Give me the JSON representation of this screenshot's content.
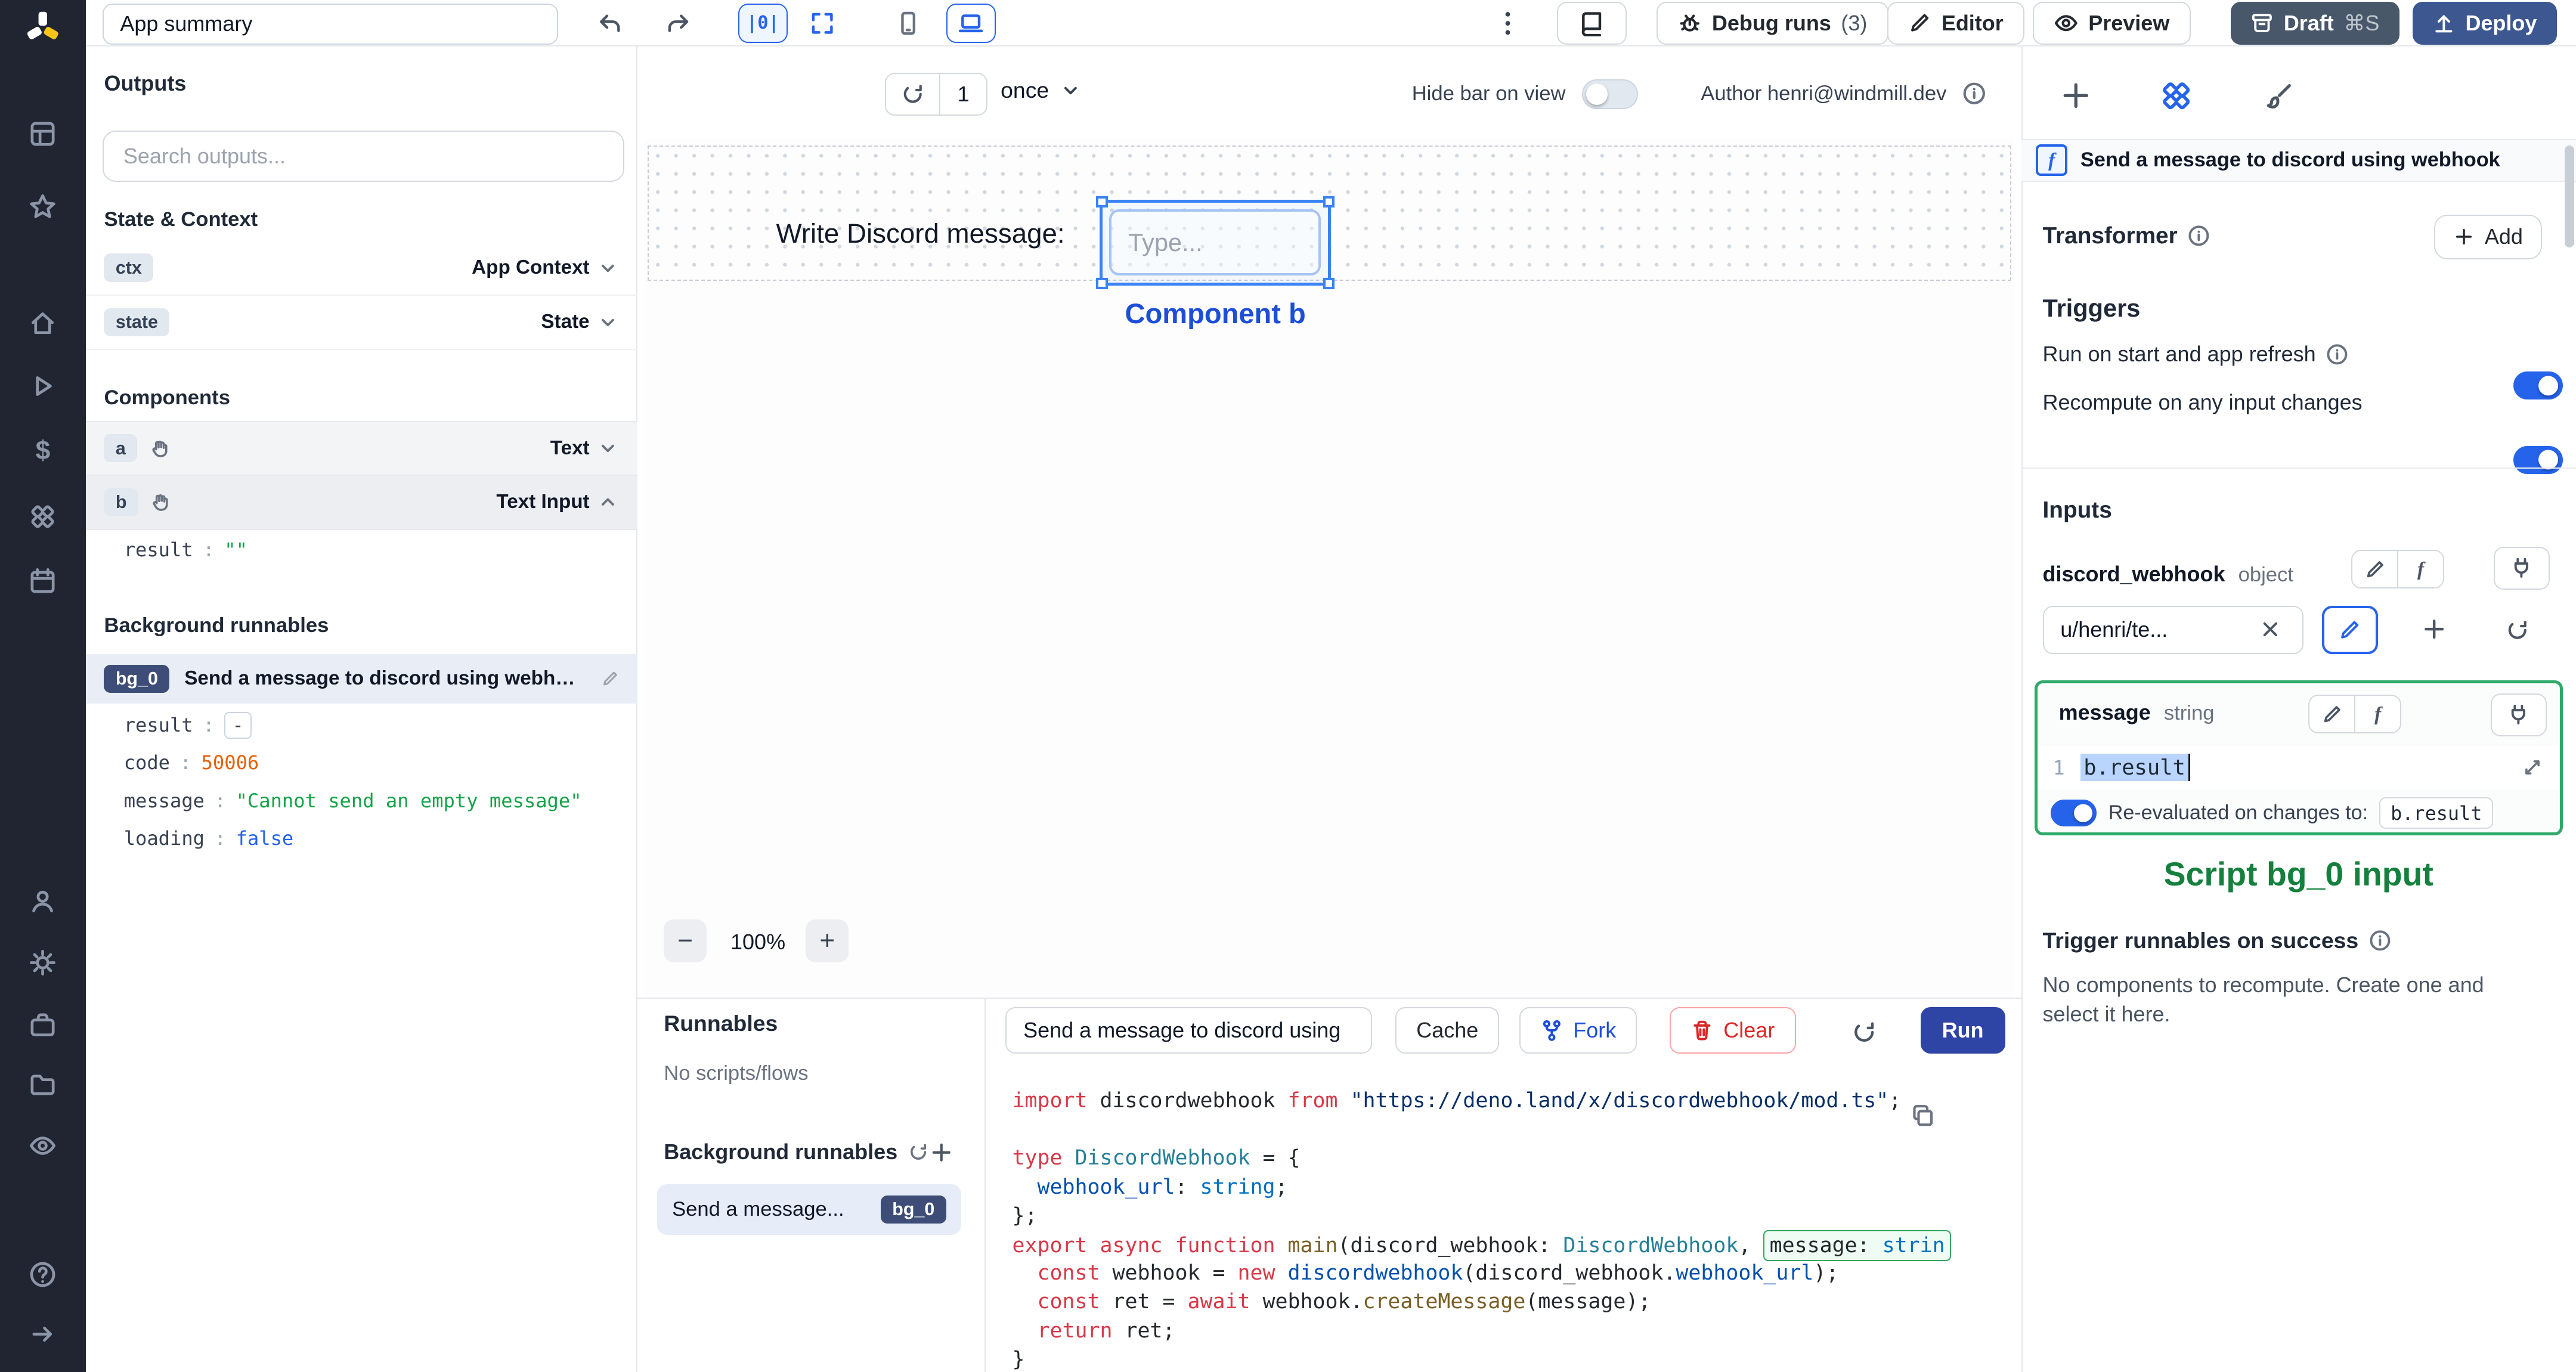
{
  "colors": {
    "accent": "#2563eb",
    "selection_blue": "#3b82f6",
    "component_label_blue": "#1d4ed8",
    "script_label_green": "#15803d",
    "number_value": "#e36209",
    "string_value": "#16a34a",
    "boolean_value": "#2563eb",
    "code_keyword": "#d73a49",
    "rail_background": "#202531"
  },
  "rail": {
    "icons": [
      "windmill-logo",
      "grid-icon",
      "star-icon",
      "home-icon",
      "play-icon",
      "dollar-icon",
      "hub-icon",
      "calendar-icon",
      "user-icon",
      "gear-icon",
      "briefcase-icon",
      "folder-icon",
      "eye-icon",
      "help-icon",
      "collapse-arrow-icon"
    ]
  },
  "left_panel": {
    "app_summary": "App summary",
    "outputs": {
      "title": "Outputs",
      "search_placeholder": "Search outputs..."
    },
    "state_context": {
      "title": "State & Context",
      "rows": [
        {
          "badge": "ctx",
          "label": "App Context"
        },
        {
          "badge": "state",
          "label": "State"
        }
      ]
    },
    "components": {
      "title": "Components",
      "rows": [
        {
          "badge": "a",
          "label": "Text"
        },
        {
          "badge": "b",
          "label": "Text Input"
        }
      ],
      "b_output": {
        "key": "result",
        "value": "\"\""
      }
    },
    "background": {
      "title": "Background runnables",
      "badge": "bg_0",
      "label": "Send a message to discord using webhook",
      "outputs": [
        {
          "key": "result",
          "value": "-"
        },
        {
          "key": "code",
          "value": "50006"
        },
        {
          "key": "message",
          "value": "\"Cannot send an empty message\""
        },
        {
          "key": "loading",
          "value": "false"
        }
      ]
    }
  },
  "toolbar": {
    "align_label": "|0|",
    "debug_runs_label": "Debug runs",
    "debug_runs_count": "(3)",
    "editor_label": "Editor",
    "preview_label": "Preview",
    "draft_label": "Draft",
    "draft_shortcut": "⌘S",
    "deploy_label": "Deploy"
  },
  "canvas": {
    "refresh_value": "1",
    "schedule": "once",
    "hide_bar_label": "Hide bar on view",
    "author_label": "Author henri@windmill.dev",
    "text_component": "Write Discord message:",
    "input_placeholder": "Type...",
    "selected_component_label": "Component b",
    "zoom_minus": "−",
    "zoom_level": "100%",
    "zoom_plus": "+"
  },
  "runnables": {
    "title": "Runnables",
    "empty_label": "No scripts/flows",
    "background_title": "Background runnables",
    "item_label": "Send a message...",
    "item_badge": "bg_0"
  },
  "editor_panel": {
    "title_value": "Send a message to discord using",
    "cache_label": "Cache",
    "fork_label": "Fork",
    "clear_label": "Clear",
    "run_label": "Run",
    "code": {
      "lines": [
        [
          [
            "kw",
            "import"
          ],
          [
            "pl",
            " discordwebhook "
          ],
          [
            "kw",
            "from"
          ],
          [
            "pl",
            " "
          ],
          [
            "str",
            "\"https://deno.land/x/discordwebhook/mod.ts\""
          ],
          [
            "pl",
            ";"
          ]
        ],
        [],
        [
          [
            "kw",
            "type"
          ],
          [
            "pl",
            " "
          ],
          [
            "ty",
            "DiscordWebhook"
          ],
          [
            "pl",
            " = {"
          ]
        ],
        [
          [
            "pl",
            "  "
          ],
          [
            "prop",
            "webhook_url"
          ],
          [
            "pl",
            ": "
          ],
          [
            "ty2",
            "string"
          ],
          [
            "pl",
            ";"
          ]
        ],
        [
          [
            "pl",
            "};"
          ]
        ],
        [
          [
            "kw",
            "export"
          ],
          [
            "pl",
            " "
          ],
          [
            "kw",
            "async"
          ],
          [
            "pl",
            " "
          ],
          [
            "kw",
            "function"
          ],
          [
            "pl",
            " "
          ],
          [
            "fn",
            "main"
          ],
          [
            "pl",
            "(discord_webhook: "
          ],
          [
            "ty",
            "DiscordWebhook"
          ],
          [
            "pl",
            ", "
          ],
          [
            "box",
            [
              [
                "pl",
                "message: "
              ],
              [
                "ty2",
                "strin"
              ]
            ]
          ]
        ],
        [
          [
            "pl",
            "  "
          ],
          [
            "kw",
            "const"
          ],
          [
            "pl",
            " webhook = "
          ],
          [
            "kw",
            "new"
          ],
          [
            "pl",
            " "
          ],
          [
            "prop",
            "discordwebhook"
          ],
          [
            "pl",
            "(discord_webhook."
          ],
          [
            "prop",
            "webhook_url"
          ],
          [
            "pl",
            ");"
          ]
        ],
        [
          [
            "pl",
            "  "
          ],
          [
            "kw",
            "const"
          ],
          [
            "pl",
            " ret = "
          ],
          [
            "kw",
            "await"
          ],
          [
            "pl",
            " webhook."
          ],
          [
            "fn",
            "createMessage"
          ],
          [
            "pl",
            "(message);"
          ]
        ],
        [
          [
            "pl",
            "  "
          ],
          [
            "kw",
            "return"
          ],
          [
            "pl",
            " ret;"
          ]
        ],
        [
          [
            "pl",
            "}"
          ]
        ]
      ]
    }
  },
  "right_panel": {
    "header_title": "Send a message to discord using webhook",
    "transformer": {
      "label": "Transformer",
      "add_label": "Add"
    },
    "triggers": {
      "title": "Triggers",
      "run_on_start": "Run on start and app refresh",
      "recompute": "Recompute on any input changes"
    },
    "inputs": {
      "title": "Inputs",
      "discord_webhook": {
        "name": "discord_webhook",
        "type": "object",
        "value": "u/henri/te..."
      },
      "message": {
        "name": "message",
        "type": "string",
        "expr_line": "1",
        "expr": "b.result",
        "reeval_label": "Re-evaluated on changes to:",
        "reeval_target": "b.result"
      }
    },
    "annotation": "Script bg_0 input",
    "on_success": {
      "title": "Trigger runnables on success",
      "description": "No components to recompute. Create one and select it here."
    }
  }
}
